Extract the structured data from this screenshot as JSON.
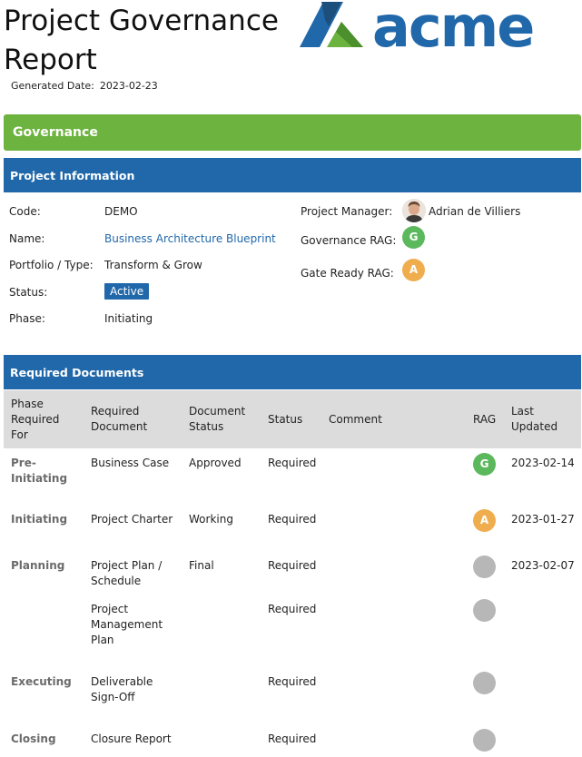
{
  "header": {
    "title": "Project Governance Report",
    "generated_label": "Generated Date:",
    "generated_value": "2023-02-23",
    "logo_text": "acme"
  },
  "colors": {
    "green_bar": "#6db33f",
    "blue_bar": "#2168aa",
    "rag_green": "#5cb85c",
    "rag_amber": "#f0ad4e",
    "rag_grey": "#b7b7b7",
    "logo_blue": "#2168aa",
    "logo_green": "#6db33f"
  },
  "governance_bar": {
    "label": "Governance"
  },
  "project_info": {
    "heading": "Project Information",
    "code_label": "Code:",
    "code_value": "DEMO",
    "name_label": "Name:",
    "name_value": "Business Architecture Blueprint",
    "portfolio_label": "Portfolio / Type:",
    "portfolio_value": "Transform & Grow",
    "status_label": "Status:",
    "status_value": "Active",
    "phase_label": "Phase:",
    "phase_value": "Initiating",
    "pm_label": "Project Manager:",
    "pm_value": "Adrian de Villiers",
    "gov_rag_label": "Governance RAG:",
    "gov_rag_value": "G",
    "gate_rag_label": "Gate Ready RAG:",
    "gate_rag_value": "A"
  },
  "required_documents": {
    "heading": "Required Documents",
    "columns": {
      "phase": [
        "Phase",
        "Required",
        "For"
      ],
      "document": [
        "Required",
        "Document"
      ],
      "doc_status": [
        "Document",
        "Status"
      ],
      "status": "Status",
      "comment": "Comment",
      "rag": "RAG",
      "updated": [
        "Last",
        "Updated"
      ]
    },
    "rows": [
      {
        "phase": [
          "Pre-",
          "Initiating"
        ],
        "document": [
          "Business Case"
        ],
        "doc_status": "Approved",
        "status": "Required",
        "comment": "",
        "rag": "G",
        "rag_color": "green",
        "updated": "2023-02-14"
      },
      {
        "phase": [
          "Initiating"
        ],
        "document": [
          "Project Charter"
        ],
        "doc_status": "Working",
        "status": "Required",
        "comment": "",
        "rag": "A",
        "rag_color": "amber",
        "updated": "2023-01-27"
      },
      {
        "phase": [
          "Planning"
        ],
        "document": [
          "Project Plan /",
          "Schedule"
        ],
        "doc_status": "Final",
        "status": "Required",
        "comment": "",
        "rag": "",
        "rag_color": "grey",
        "updated": "2023-02-07"
      },
      {
        "phase": [],
        "document": [
          "Project",
          "Management",
          "Plan"
        ],
        "doc_status": "",
        "status": "Required",
        "comment": "",
        "rag": "",
        "rag_color": "grey",
        "updated": ""
      },
      {
        "phase": [
          "Executing"
        ],
        "document": [
          "Deliverable",
          "Sign-Off"
        ],
        "doc_status": "",
        "status": "Required",
        "comment": "",
        "rag": "",
        "rag_color": "grey",
        "updated": ""
      },
      {
        "phase": [
          "Closing"
        ],
        "document": [
          "Closure Report"
        ],
        "doc_status": "",
        "status": "Required",
        "comment": "",
        "rag": "",
        "rag_color": "grey",
        "updated": ""
      }
    ]
  }
}
